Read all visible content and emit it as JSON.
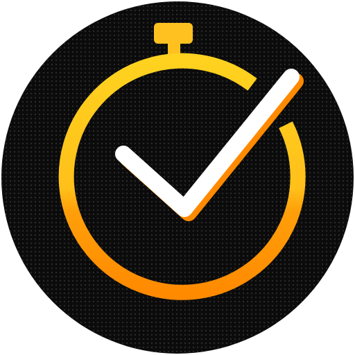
{
  "icon": {
    "name": "stopwatch-check-icon",
    "colors": {
      "background": "#ffffff",
      "disc": "#0b0b0b",
      "disc_dots": "#2a2a2a",
      "ring_top": "#ffc71e",
      "ring_bottom": "#ff8a00",
      "crown": "#ffc120",
      "check": "#ffffff",
      "check_shadow": "#ff8a00"
    }
  }
}
